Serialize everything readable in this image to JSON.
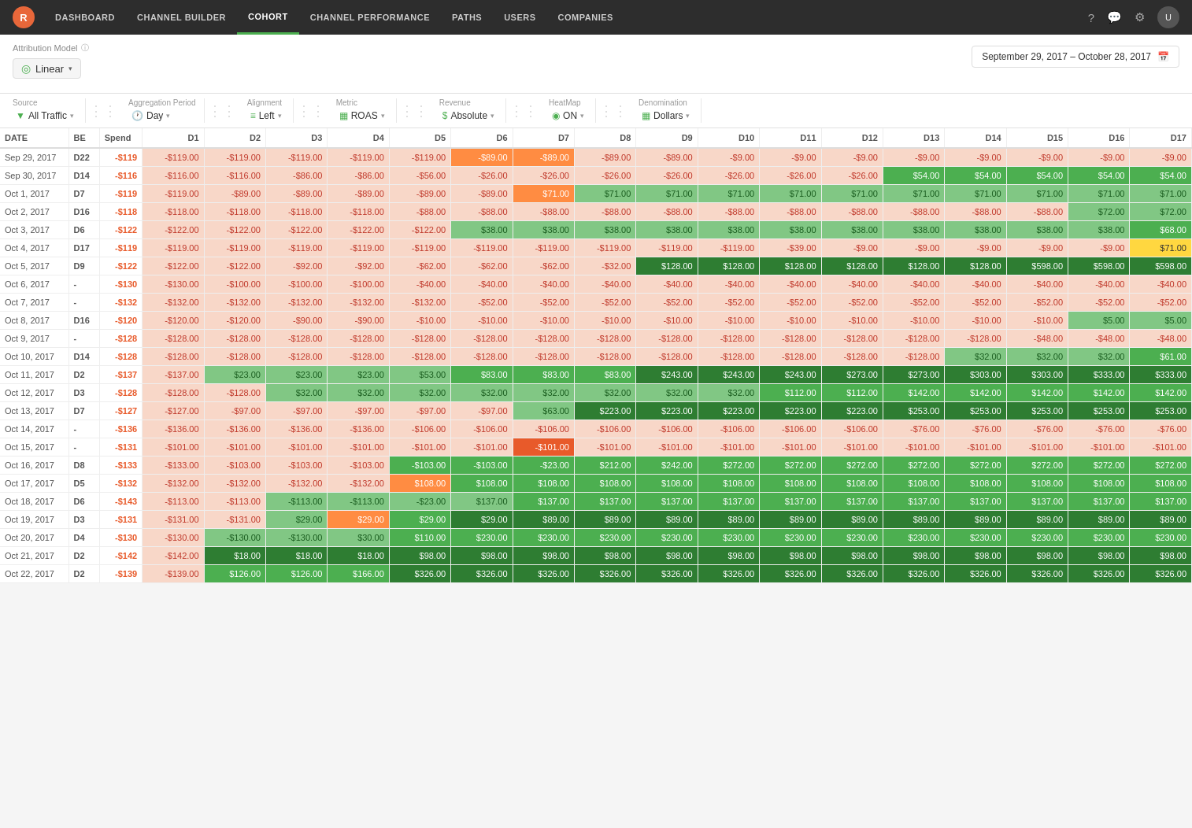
{
  "nav": {
    "logo": "R",
    "items": [
      {
        "label": "Dashboard",
        "active": false
      },
      {
        "label": "Channel Builder",
        "active": false
      },
      {
        "label": "Cohort",
        "active": true
      },
      {
        "label": "Channel Performance",
        "active": false
      },
      {
        "label": "Paths",
        "active": false
      },
      {
        "label": "Users",
        "active": false
      },
      {
        "label": "Companies",
        "active": false
      }
    ]
  },
  "attribution": {
    "label": "Attribution Model",
    "model": "Linear",
    "date_range": "September 29, 2017  –  October 28, 2017"
  },
  "filters": {
    "source_label": "Source",
    "source_value": "All Traffic",
    "aggregation_label": "Aggregation Period",
    "aggregation_value": "Day",
    "alignment_label": "Alignment",
    "alignment_value": "Left",
    "metric_label": "Metric",
    "metric_value": "ROAS",
    "revenue_label": "Revenue",
    "revenue_value": "Absolute",
    "heatmap_label": "HeatMap",
    "heatmap_value": "ON",
    "denomination_label": "Denomination",
    "denomination_value": "Dollars"
  },
  "table": {
    "headers": [
      "DATE",
      "BE",
      "Spend",
      "D1",
      "D2",
      "D3",
      "D4",
      "D5",
      "D6",
      "D7",
      "D8",
      "D9",
      "D10",
      "D11",
      "D12",
      "D13",
      "D14",
      "D15",
      "D16",
      "D17"
    ],
    "rows": [
      {
        "date": "Sep 29, 2017",
        "be": "D22",
        "spend": "-$119",
        "d1": "-$119.00",
        "d2": "-$119.00",
        "d3": "-$119.00",
        "d4": "-$119.00",
        "d5": "-$119.00",
        "d6": "-$89.00",
        "d7": "-$89.00",
        "d8": "-$89.00",
        "d9": "-$89.00",
        "d10": "-$9.00",
        "d11": "-$9.00",
        "d12": "-$9.00",
        "d13": "-$9.00",
        "d14": "-$9.00",
        "d15": "-$9.00",
        "d16": "-$9.00",
        "d17": "-$9.00"
      },
      {
        "date": "Sep 30, 2017",
        "be": "D14",
        "spend": "-$116",
        "d1": "-$116.00",
        "d2": "-$116.00",
        "d3": "-$86.00",
        "d4": "-$86.00",
        "d5": "-$56.00",
        "d6": "-$26.00",
        "d7": "-$26.00",
        "d8": "-$26.00",
        "d9": "-$26.00",
        "d10": "-$26.00",
        "d11": "-$26.00",
        "d12": "-$26.00",
        "d13": "$54.00",
        "d14": "$54.00",
        "d15": "$54.00",
        "d16": "$54.00",
        "d17": "$54.00"
      },
      {
        "date": "Oct 1, 2017",
        "be": "D7",
        "spend": "-$119",
        "d1": "-$119.00",
        "d2": "-$89.00",
        "d3": "-$89.00",
        "d4": "-$89.00",
        "d5": "-$89.00",
        "d6": "-$89.00",
        "d7": "$71.00",
        "d8": "$71.00",
        "d9": "$71.00",
        "d10": "$71.00",
        "d11": "$71.00",
        "d12": "$71.00",
        "d13": "$71.00",
        "d14": "$71.00",
        "d15": "$71.00",
        "d16": "$71.00",
        "d17": "$71.00"
      },
      {
        "date": "Oct 2, 2017",
        "be": "D16",
        "spend": "-$118",
        "d1": "-$118.00",
        "d2": "-$118.00",
        "d3": "-$118.00",
        "d4": "-$118.00",
        "d5": "-$88.00",
        "d6": "-$88.00",
        "d7": "-$88.00",
        "d8": "-$88.00",
        "d9": "-$88.00",
        "d10": "-$88.00",
        "d11": "-$88.00",
        "d12": "-$88.00",
        "d13": "-$88.00",
        "d14": "-$88.00",
        "d15": "-$88.00",
        "d16": "$72.00",
        "d17": "$72.00"
      },
      {
        "date": "Oct 3, 2017",
        "be": "D6",
        "spend": "-$122",
        "d1": "-$122.00",
        "d2": "-$122.00",
        "d3": "-$122.00",
        "d4": "-$122.00",
        "d5": "-$122.00",
        "d6": "$38.00",
        "d7": "$38.00",
        "d8": "$38.00",
        "d9": "$38.00",
        "d10": "$38.00",
        "d11": "$38.00",
        "d12": "$38.00",
        "d13": "$38.00",
        "d14": "$38.00",
        "d15": "$38.00",
        "d16": "$38.00",
        "d17": "$68.00"
      },
      {
        "date": "Oct 4, 2017",
        "be": "D17",
        "spend": "-$119",
        "d1": "-$119.00",
        "d2": "-$119.00",
        "d3": "-$119.00",
        "d4": "-$119.00",
        "d5": "-$119.00",
        "d6": "-$119.00",
        "d7": "-$119.00",
        "d8": "-$119.00",
        "d9": "-$119.00",
        "d10": "-$119.00",
        "d11": "-$39.00",
        "d12": "-$9.00",
        "d13": "-$9.00",
        "d14": "-$9.00",
        "d15": "-$9.00",
        "d16": "-$9.00",
        "d17": "$71.00"
      },
      {
        "date": "Oct 5, 2017",
        "be": "D9",
        "spend": "-$122",
        "d1": "-$122.00",
        "d2": "-$122.00",
        "d3": "-$92.00",
        "d4": "-$92.00",
        "d5": "-$62.00",
        "d6": "-$62.00",
        "d7": "-$62.00",
        "d8": "-$32.00",
        "d9": "$128.00",
        "d10": "$128.00",
        "d11": "$128.00",
        "d12": "$128.00",
        "d13": "$128.00",
        "d14": "$128.00",
        "d15": "$598.00",
        "d16": "$598.00",
        "d17": "$598.00"
      },
      {
        "date": "Oct 6, 2017",
        "be": "-",
        "spend": "-$130",
        "d1": "-$130.00",
        "d2": "-$100.00",
        "d3": "-$100.00",
        "d4": "-$100.00",
        "d5": "-$40.00",
        "d6": "-$40.00",
        "d7": "-$40.00",
        "d8": "-$40.00",
        "d9": "-$40.00",
        "d10": "-$40.00",
        "d11": "-$40.00",
        "d12": "-$40.00",
        "d13": "-$40.00",
        "d14": "-$40.00",
        "d15": "-$40.00",
        "d16": "-$40.00",
        "d17": "-$40.00"
      },
      {
        "date": "Oct 7, 2017",
        "be": "-",
        "spend": "-$132",
        "d1": "-$132.00",
        "d2": "-$132.00",
        "d3": "-$132.00",
        "d4": "-$132.00",
        "d5": "-$132.00",
        "d6": "-$52.00",
        "d7": "-$52.00",
        "d8": "-$52.00",
        "d9": "-$52.00",
        "d10": "-$52.00",
        "d11": "-$52.00",
        "d12": "-$52.00",
        "d13": "-$52.00",
        "d14": "-$52.00",
        "d15": "-$52.00",
        "d16": "-$52.00",
        "d17": "-$52.00"
      },
      {
        "date": "Oct 8, 2017",
        "be": "D16",
        "spend": "-$120",
        "d1": "-$120.00",
        "d2": "-$120.00",
        "d3": "-$90.00",
        "d4": "-$90.00",
        "d5": "-$10.00",
        "d6": "-$10.00",
        "d7": "-$10.00",
        "d8": "-$10.00",
        "d9": "-$10.00",
        "d10": "-$10.00",
        "d11": "-$10.00",
        "d12": "-$10.00",
        "d13": "-$10.00",
        "d14": "-$10.00",
        "d15": "-$10.00",
        "d16": "$5.00",
        "d17": "$5.00"
      },
      {
        "date": "Oct 9, 2017",
        "be": "-",
        "spend": "-$128",
        "d1": "-$128.00",
        "d2": "-$128.00",
        "d3": "-$128.00",
        "d4": "-$128.00",
        "d5": "-$128.00",
        "d6": "-$128.00",
        "d7": "-$128.00",
        "d8": "-$128.00",
        "d9": "-$128.00",
        "d10": "-$128.00",
        "d11": "-$128.00",
        "d12": "-$128.00",
        "d13": "-$128.00",
        "d14": "-$128.00",
        "d15": "-$48.00",
        "d16": "-$48.00",
        "d17": "-$48.00"
      },
      {
        "date": "Oct 10, 2017",
        "be": "D14",
        "spend": "-$128",
        "d1": "-$128.00",
        "d2": "-$128.00",
        "d3": "-$128.00",
        "d4": "-$128.00",
        "d5": "-$128.00",
        "d6": "-$128.00",
        "d7": "-$128.00",
        "d8": "-$128.00",
        "d9": "-$128.00",
        "d10": "-$128.00",
        "d11": "-$128.00",
        "d12": "-$128.00",
        "d13": "-$128.00",
        "d14": "$32.00",
        "d15": "$32.00",
        "d16": "$32.00",
        "d17": "$61.00"
      },
      {
        "date": "Oct 11, 2017",
        "be": "D2",
        "spend": "-$137",
        "d1": "-$137.00",
        "d2": "$23.00",
        "d3": "$23.00",
        "d4": "$23.00",
        "d5": "$53.00",
        "d6": "$83.00",
        "d7": "$83.00",
        "d8": "$83.00",
        "d9": "$243.00",
        "d10": "$243.00",
        "d11": "$243.00",
        "d12": "$273.00",
        "d13": "$273.00",
        "d14": "$303.00",
        "d15": "$303.00",
        "d16": "$333.00",
        "d17": "$333.00"
      },
      {
        "date": "Oct 12, 2017",
        "be": "D3",
        "spend": "-$128",
        "d1": "-$128.00",
        "d2": "-$128.00",
        "d3": "$32.00",
        "d4": "$32.00",
        "d5": "$32.00",
        "d6": "$32.00",
        "d7": "$32.00",
        "d8": "$32.00",
        "d9": "$32.00",
        "d10": "$32.00",
        "d11": "$112.00",
        "d12": "$112.00",
        "d13": "$142.00",
        "d14": "$142.00",
        "d15": "$142.00",
        "d16": "$142.00",
        "d17": "$142.00"
      },
      {
        "date": "Oct 13, 2017",
        "be": "D7",
        "spend": "-$127",
        "d1": "-$127.00",
        "d2": "-$97.00",
        "d3": "-$97.00",
        "d4": "-$97.00",
        "d5": "-$97.00",
        "d6": "-$97.00",
        "d7": "$63.00",
        "d8": "$223.00",
        "d9": "$223.00",
        "d10": "$223.00",
        "d11": "$223.00",
        "d12": "$223.00",
        "d13": "$253.00",
        "d14": "$253.00",
        "d15": "$253.00",
        "d16": "$253.00",
        "d17": "$253.00"
      },
      {
        "date": "Oct 14, 2017",
        "be": "-",
        "spend": "-$136",
        "d1": "-$136.00",
        "d2": "-$136.00",
        "d3": "-$136.00",
        "d4": "-$136.00",
        "d5": "-$106.00",
        "d6": "-$106.00",
        "d7": "-$106.00",
        "d8": "-$106.00",
        "d9": "-$106.00",
        "d10": "-$106.00",
        "d11": "-$106.00",
        "d12": "-$106.00",
        "d13": "-$76.00",
        "d14": "-$76.00",
        "d15": "-$76.00",
        "d16": "-$76.00",
        "d17": "-$76.00"
      },
      {
        "date": "Oct 15, 2017",
        "be": "-",
        "spend": "-$131",
        "d1": "-$101.00",
        "d2": "-$101.00",
        "d3": "-$101.00",
        "d4": "-$101.00",
        "d5": "-$101.00",
        "d6": "-$101.00",
        "d7": "-$101.00",
        "d8": "-$101.00",
        "d9": "-$101.00",
        "d10": "-$101.00",
        "d11": "-$101.00",
        "d12": "-$101.00",
        "d13": "-$101.00",
        "d14": "-$101.00",
        "d15": "-$101.00",
        "d16": "-$101.00",
        "d17": "-$101.00"
      },
      {
        "date": "Oct 16, 2017",
        "be": "D8",
        "spend": "-$133",
        "d1": "-$133.00",
        "d2": "-$103.00",
        "d3": "-$103.00",
        "d4": "-$103.00",
        "d5": "-$103.00",
        "d6": "-$103.00",
        "d7": "-$23.00",
        "d8": "$212.00",
        "d9": "$242.00",
        "d10": "$272.00",
        "d11": "$272.00",
        "d12": "$272.00",
        "d13": "$272.00",
        "d14": "$272.00",
        "d15": "$272.00",
        "d16": "$272.00",
        "d17": "$272.00"
      },
      {
        "date": "Oct 17, 2017",
        "be": "D5",
        "spend": "-$132",
        "d1": "-$132.00",
        "d2": "-$132.00",
        "d3": "-$132.00",
        "d4": "-$132.00",
        "d5": "$108.00",
        "d6": "$108.00",
        "d7": "$108.00",
        "d8": "$108.00",
        "d9": "$108.00",
        "d10": "$108.00",
        "d11": "$108.00",
        "d12": "$108.00",
        "d13": "$108.00",
        "d14": "$108.00",
        "d15": "$108.00",
        "d16": "$108.00",
        "d17": "$108.00"
      },
      {
        "date": "Oct 18, 2017",
        "be": "D6",
        "spend": "-$143",
        "d1": "-$113.00",
        "d2": "-$113.00",
        "d3": "-$113.00",
        "d4": "-$113.00",
        "d5": "-$23.00",
        "d6": "$137.00",
        "d7": "$137.00",
        "d8": "$137.00",
        "d9": "$137.00",
        "d10": "$137.00",
        "d11": "$137.00",
        "d12": "$137.00",
        "d13": "$137.00",
        "d14": "$137.00",
        "d15": "$137.00",
        "d16": "$137.00",
        "d17": "$137.00"
      },
      {
        "date": "Oct 19, 2017",
        "be": "D3",
        "spend": "-$131",
        "d1": "-$131.00",
        "d2": "-$131.00",
        "d3": "$29.00",
        "d4": "$29.00",
        "d5": "$29.00",
        "d6": "$29.00",
        "d7": "$89.00",
        "d8": "$89.00",
        "d9": "$89.00",
        "d10": "$89.00",
        "d11": "$89.00",
        "d12": "$89.00",
        "d13": "$89.00",
        "d14": "$89.00",
        "d15": "$89.00",
        "d16": "$89.00",
        "d17": "$89.00"
      },
      {
        "date": "Oct 20, 2017",
        "be": "D4",
        "spend": "-$130",
        "d1": "-$130.00",
        "d2": "-$130.00",
        "d3": "-$130.00",
        "d4": "$30.00",
        "d5": "$110.00",
        "d6": "$230.00",
        "d7": "$230.00",
        "d8": "$230.00",
        "d9": "$230.00",
        "d10": "$230.00",
        "d11": "$230.00",
        "d12": "$230.00",
        "d13": "$230.00",
        "d14": "$230.00",
        "d15": "$230.00",
        "d16": "$230.00",
        "d17": "$230.00"
      },
      {
        "date": "Oct 21, 2017",
        "be": "D2",
        "spend": "-$142",
        "d1": "-$142.00",
        "d2": "$18.00",
        "d3": "$18.00",
        "d4": "$18.00",
        "d5": "$98.00",
        "d6": "$98.00",
        "d7": "$98.00",
        "d8": "$98.00",
        "d9": "$98.00",
        "d10": "$98.00",
        "d11": "$98.00",
        "d12": "$98.00",
        "d13": "$98.00",
        "d14": "$98.00",
        "d15": "$98.00",
        "d16": "$98.00",
        "d17": "$98.00"
      },
      {
        "date": "Oct 22, 2017",
        "be": "D2",
        "spend": "-$139",
        "d1": "-$139.00",
        "d2": "$126.00",
        "d3": "$126.00",
        "d4": "$166.00",
        "d5": "$326.00",
        "d6": "$326.00",
        "d7": "$326.00",
        "d8": "$326.00",
        "d9": "$326.00",
        "d10": "$326.00",
        "d11": "$326.00",
        "d12": "$326.00",
        "d13": "$326.00",
        "d14": "$326.00",
        "d15": "$326.00",
        "d16": "$326.00",
        "d17": "$326.00"
      }
    ]
  }
}
